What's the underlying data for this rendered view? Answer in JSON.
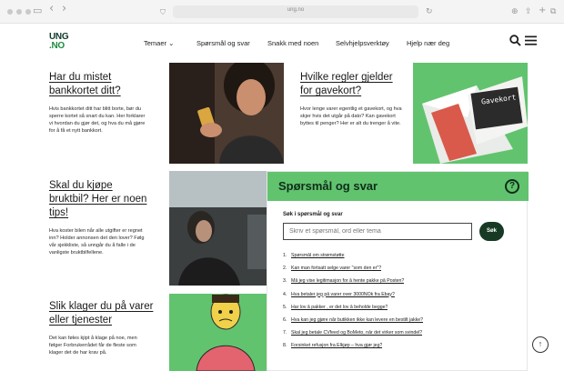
{
  "browser": {
    "url": "ung.no",
    "back_glyph": "‹",
    "forward_glyph": "›"
  },
  "header": {
    "logo_top": "UNG",
    "logo_bottom": ".NO",
    "nav": [
      "Temaer ⌄",
      "Spørsmål og svar",
      "Snakk med noen",
      "Selvhjelpsverktøy",
      "Hjelp nær deg"
    ]
  },
  "cards": [
    {
      "title": "Har du mistet bankkortet ditt?",
      "text": "Hvis bankkortet ditt har blitt borte, bør du sperre kortet så snart du kan. Her forklarer vi hvordan du gjør det, og hva du må gjøre for å få et nytt bankkort."
    },
    {
      "title": "Hvilke regler gjelder for gavekort?",
      "text": "Hvor lenge varer egentlig et gavekort, og hva skjer hvis det utgår på dato? Kan gavekort byttes til penger? Her er alt du trenger å vite.",
      "image_text": "Gavekort"
    },
    {
      "title": "Skal du kjøpe bruktbil? Her er noen tips!",
      "text": "Hva koster bilen når alle utgifter er regnet inn? Holder annonsen det den lover? Følg vår sjekkliste, så unngår du å falle i de vanligste bruktbilfellene."
    },
    {
      "title": "Slik klager du på varer eller tjenester",
      "text": "Det kan føles kjipt å klage på noe, men følger Forbrukerrådet får de fleste som klager det de har krav på."
    }
  ],
  "qa": {
    "title": "Spørsmål og svar",
    "help_glyph": "?",
    "search_label": "Søk i spørsmål og svar",
    "search_placeholder": "Skriv et spørsmål, ord eller tema",
    "search_button": "Søk",
    "questions": [
      "Spørsmål om strømstøtte",
      "Kan man fortsatt selge varer \"som den er\"?",
      "Må jeg vise legitimasjon for å hente pakke på Posten?",
      "Hva betaler jeg på varer over 3000NOk fra Ebay?",
      "Har lov å pakker , er det lov å beholde begge?",
      "Hva kan jeg gjøre når butikken ikke kan levere en bestilt jakke?",
      "Skal jeg betale CVfeed og BoMeto, når det virker som svindel?",
      "Forsinket refusjon fra Elkjøp – hva gjør jeg?"
    ]
  },
  "colors": {
    "accent_green": "#62c36f",
    "dark_green": "#173a24"
  }
}
